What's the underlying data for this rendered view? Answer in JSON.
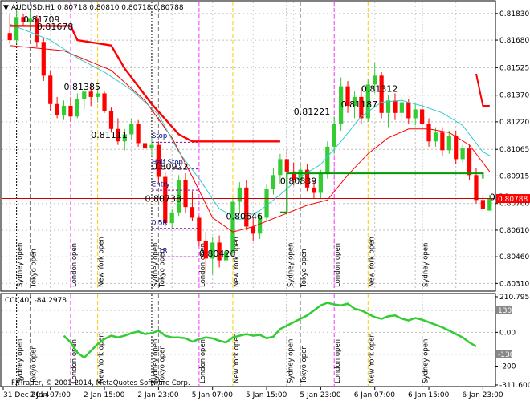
{
  "chart_data": {
    "type": "candlestick",
    "title": "AUDUSD,H1 0.80718 0.80810 0.80718 0.80788",
    "symbol": "AUDUSD,H1",
    "ohlc_header": [
      0.80718,
      0.8081,
      0.80718,
      0.80788
    ],
    "current_price": "0.80788",
    "price_axis": {
      "ylim": [
        0.8028,
        0.8187
      ],
      "ticks": [
        "0.81830",
        "0.81680",
        "0.81525",
        "0.81370",
        "0.81220",
        "0.81065",
        "0.80915",
        "0.80760",
        "0.80610",
        "0.80460",
        "0.80310"
      ]
    },
    "x_axis": {
      "ticks": [
        "31 Dec 2014",
        "2 Jan 07:00",
        "2 Jan 15:00",
        "2 Jan 23:00",
        "5 Jan 07:00",
        "5 Jan 15:00",
        "5 Jan 23:00",
        "6 Jan 07:00",
        "6 Jan 15:00",
        "6 Jan 23:00"
      ]
    },
    "candles": [
      {
        "o": 0.8172,
        "h": 0.8183,
        "l": 0.8166,
        "c": 0.8168
      },
      {
        "o": 0.8168,
        "h": 0.8185,
        "l": 0.8166,
        "c": 0.8181
      },
      {
        "o": 0.8181,
        "h": 0.8183,
        "l": 0.8176,
        "c": 0.8178
      },
      {
        "o": 0.8178,
        "h": 0.8184,
        "l": 0.8175,
        "c": 0.818
      },
      {
        "o": 0.818,
        "h": 0.8182,
        "l": 0.8164,
        "c": 0.8167
      },
      {
        "o": 0.8167,
        "h": 0.8169,
        "l": 0.8145,
        "c": 0.8148
      },
      {
        "o": 0.8148,
        "h": 0.8151,
        "l": 0.8128,
        "c": 0.8132
      },
      {
        "o": 0.8132,
        "h": 0.8136,
        "l": 0.8124,
        "c": 0.8126
      },
      {
        "o": 0.8126,
        "h": 0.8134,
        "l": 0.8123,
        "c": 0.8131
      },
      {
        "o": 0.8131,
        "h": 0.8136,
        "l": 0.8122,
        "c": 0.8125
      },
      {
        "o": 0.8125,
        "h": 0.8138,
        "l": 0.8124,
        "c": 0.8135
      },
      {
        "o": 0.8135,
        "h": 0.8141,
        "l": 0.8129,
        "c": 0.8139
      },
      {
        "o": 0.8139,
        "h": 0.8143,
        "l": 0.8131,
        "c": 0.8136
      },
      {
        "o": 0.8136,
        "h": 0.8141,
        "l": 0.8133,
        "c": 0.8138
      },
      {
        "o": 0.8138,
        "h": 0.8139,
        "l": 0.8127,
        "c": 0.8128
      },
      {
        "o": 0.8128,
        "h": 0.813,
        "l": 0.8116,
        "c": 0.8118
      },
      {
        "o": 0.8118,
        "h": 0.8124,
        "l": 0.8109,
        "c": 0.8111
      },
      {
        "o": 0.8111,
        "h": 0.8118,
        "l": 0.8106,
        "c": 0.8115
      },
      {
        "o": 0.8115,
        "h": 0.8124,
        "l": 0.8112,
        "c": 0.8121
      },
      {
        "o": 0.8121,
        "h": 0.8123,
        "l": 0.8108,
        "c": 0.811
      },
      {
        "o": 0.811,
        "h": 0.8114,
        "l": 0.8104,
        "c": 0.8107
      },
      {
        "o": 0.8107,
        "h": 0.8113,
        "l": 0.8103,
        "c": 0.8109
      },
      {
        "o": 0.8109,
        "h": 0.8111,
        "l": 0.8088,
        "c": 0.8091
      },
      {
        "o": 0.8091,
        "h": 0.8094,
        "l": 0.8063,
        "c": 0.8065
      },
      {
        "o": 0.8065,
        "h": 0.8073,
        "l": 0.8062,
        "c": 0.8071
      },
      {
        "o": 0.8071,
        "h": 0.8092,
        "l": 0.8069,
        "c": 0.8089
      },
      {
        "o": 0.8089,
        "h": 0.8093,
        "l": 0.8071,
        "c": 0.8074
      },
      {
        "o": 0.8074,
        "h": 0.8083,
        "l": 0.8066,
        "c": 0.8068
      },
      {
        "o": 0.8068,
        "h": 0.8069,
        "l": 0.8052,
        "c": 0.8055
      },
      {
        "o": 0.8055,
        "h": 0.806,
        "l": 0.8037,
        "c": 0.8045
      },
      {
        "o": 0.8045,
        "h": 0.8057,
        "l": 0.8036,
        "c": 0.8054
      },
      {
        "o": 0.8054,
        "h": 0.8058,
        "l": 0.804,
        "c": 0.8044
      },
      {
        "o": 0.8044,
        "h": 0.8051,
        "l": 0.8038,
        "c": 0.8049
      },
      {
        "o": 0.8049,
        "h": 0.8079,
        "l": 0.8046,
        "c": 0.8077
      },
      {
        "o": 0.8077,
        "h": 0.8088,
        "l": 0.807,
        "c": 0.8085
      },
      {
        "o": 0.8085,
        "h": 0.8089,
        "l": 0.8061,
        "c": 0.8063
      },
      {
        "o": 0.8063,
        "h": 0.8068,
        "l": 0.8055,
        "c": 0.8059
      },
      {
        "o": 0.8059,
        "h": 0.8071,
        "l": 0.8056,
        "c": 0.8068
      },
      {
        "o": 0.8068,
        "h": 0.8087,
        "l": 0.8066,
        "c": 0.8084
      },
      {
        "o": 0.8084,
        "h": 0.8096,
        "l": 0.8081,
        "c": 0.8092
      },
      {
        "o": 0.8092,
        "h": 0.8104,
        "l": 0.8087,
        "c": 0.8101
      },
      {
        "o": 0.8101,
        "h": 0.8106,
        "l": 0.8091,
        "c": 0.8094
      },
      {
        "o": 0.8094,
        "h": 0.8099,
        "l": 0.8086,
        "c": 0.8089
      },
      {
        "o": 0.8089,
        "h": 0.8097,
        "l": 0.8087,
        "c": 0.8095
      },
      {
        "o": 0.8095,
        "h": 0.8098,
        "l": 0.8083,
        "c": 0.8085
      },
      {
        "o": 0.8085,
        "h": 0.8089,
        "l": 0.8079,
        "c": 0.8082
      },
      {
        "o": 0.8082,
        "h": 0.8095,
        "l": 0.8079,
        "c": 0.8093
      },
      {
        "o": 0.8093,
        "h": 0.8111,
        "l": 0.809,
        "c": 0.8108
      },
      {
        "o": 0.8108,
        "h": 0.8125,
        "l": 0.8104,
        "c": 0.8121
      },
      {
        "o": 0.8121,
        "h": 0.8147,
        "l": 0.8117,
        "c": 0.8142
      },
      {
        "o": 0.8142,
        "h": 0.8145,
        "l": 0.8127,
        "c": 0.8131
      },
      {
        "o": 0.8131,
        "h": 0.8139,
        "l": 0.8124,
        "c": 0.8136
      },
      {
        "o": 0.8136,
        "h": 0.8141,
        "l": 0.8121,
        "c": 0.8124
      },
      {
        "o": 0.8124,
        "h": 0.8146,
        "l": 0.8122,
        "c": 0.8143
      },
      {
        "o": 0.8143,
        "h": 0.8155,
        "l": 0.8138,
        "c": 0.8148
      },
      {
        "o": 0.8148,
        "h": 0.815,
        "l": 0.8124,
        "c": 0.8127
      },
      {
        "o": 0.8127,
        "h": 0.8137,
        "l": 0.8119,
        "c": 0.8134
      },
      {
        "o": 0.8134,
        "h": 0.8138,
        "l": 0.8123,
        "c": 0.8127
      },
      {
        "o": 0.8127,
        "h": 0.8136,
        "l": 0.8122,
        "c": 0.8133
      },
      {
        "o": 0.8133,
        "h": 0.8135,
        "l": 0.8121,
        "c": 0.8124
      },
      {
        "o": 0.8124,
        "h": 0.8132,
        "l": 0.812,
        "c": 0.8129
      },
      {
        "o": 0.8129,
        "h": 0.8133,
        "l": 0.8118,
        "c": 0.8121
      },
      {
        "o": 0.8121,
        "h": 0.8124,
        "l": 0.8108,
        "c": 0.8111
      },
      {
        "o": 0.8111,
        "h": 0.8119,
        "l": 0.8108,
        "c": 0.8116
      },
      {
        "o": 0.8116,
        "h": 0.8119,
        "l": 0.8103,
        "c": 0.8106
      },
      {
        "o": 0.8106,
        "h": 0.8117,
        "l": 0.8104,
        "c": 0.8114
      },
      {
        "o": 0.8114,
        "h": 0.8117,
        "l": 0.8098,
        "c": 0.8101
      },
      {
        "o": 0.8101,
        "h": 0.8109,
        "l": 0.8099,
        "c": 0.8107
      },
      {
        "o": 0.8107,
        "h": 0.8109,
        "l": 0.8089,
        "c": 0.8092
      },
      {
        "o": 0.8092,
        "h": 0.8096,
        "l": 0.8076,
        "c": 0.8078
      },
      {
        "o": 0.8078,
        "h": 0.8081,
        "l": 0.8072,
        "c": 0.8073
      },
      {
        "o": 0.8072,
        "h": 0.8081,
        "l": 0.8072,
        "c": 0.8079
      }
    ],
    "ma_fast": [
      [
        0,
        0.8177
      ],
      [
        6,
        0.8168
      ],
      [
        10,
        0.8158
      ],
      [
        14,
        0.815
      ],
      [
        18,
        0.814
      ],
      [
        22,
        0.8126
      ],
      [
        25,
        0.8105
      ],
      [
        28,
        0.809
      ],
      [
        31,
        0.8073
      ],
      [
        34,
        0.8067
      ],
      [
        37,
        0.8072
      ],
      [
        40,
        0.8081
      ],
      [
        43,
        0.8091
      ],
      [
        46,
        0.8098
      ],
      [
        49,
        0.8111
      ],
      [
        52,
        0.8125
      ],
      [
        55,
        0.8133
      ],
      [
        58,
        0.8134
      ],
      [
        61,
        0.8131
      ],
      [
        64,
        0.8127
      ],
      [
        67,
        0.812
      ],
      [
        70,
        0.8105
      ],
      [
        71,
        0.8103
      ]
    ],
    "ma_slow": [
      [
        0,
        0.8165
      ],
      [
        8,
        0.8162
      ],
      [
        15,
        0.8151
      ],
      [
        20,
        0.8134
      ],
      [
        24,
        0.8113
      ],
      [
        27,
        0.8091
      ],
      [
        30,
        0.8068
      ],
      [
        33,
        0.806
      ],
      [
        36,
        0.8063
      ],
      [
        40,
        0.8069
      ],
      [
        44,
        0.8075
      ],
      [
        47,
        0.8078
      ],
      [
        50,
        0.8092
      ],
      [
        53,
        0.8104
      ],
      [
        56,
        0.8113
      ],
      [
        59,
        0.8118
      ],
      [
        62,
        0.8118
      ],
      [
        65,
        0.8116
      ],
      [
        68,
        0.8109
      ],
      [
        71,
        0.8094
      ]
    ],
    "stop_line": [
      [
        0,
        0.8176
      ],
      [
        9,
        0.8176
      ],
      [
        10,
        0.8168
      ],
      [
        15,
        0.8165
      ],
      [
        17,
        0.8152
      ],
      [
        21,
        0.8132
      ],
      [
        25,
        0.8115
      ],
      [
        27,
        0.8111
      ],
      [
        40,
        0.8111
      ]
    ],
    "stop_line2": [
      [
        69,
        0.8149
      ],
      [
        70,
        0.8131
      ],
      [
        71,
        0.8131
      ]
    ],
    "green_line": [
      [
        40,
        0.8071
      ],
      [
        41,
        0.8071
      ],
      [
        41,
        0.8093
      ],
      [
        70,
        0.8093
      ],
      [
        70,
        0.809
      ]
    ],
    "horizontal_line": 0.80788,
    "level_labels": [
      {
        "text": "0.81709",
        "bar": 2,
        "y": 0.8178
      },
      {
        "text": "0.81678",
        "bar": 4,
        "y": 0.8174
      },
      {
        "text": "0.81385",
        "bar": 8,
        "y": 0.814
      },
      {
        "text": "0.81111",
        "bar": 12,
        "y": 0.8113
      },
      {
        "text": "0.80922",
        "bar": 21,
        "y": 0.8095
      },
      {
        "text": "0.80738",
        "bar": 20,
        "y": 0.8077
      },
      {
        "text": "0.80646",
        "bar": 32,
        "y": 0.8067
      },
      {
        "text": "0.80426",
        "bar": 28,
        "y": 0.8046
      },
      {
        "text": "0.80839",
        "bar": 40,
        "y": 0.8087
      },
      {
        "text": "0.81221",
        "bar": 42,
        "y": 0.8126
      },
      {
        "text": "0.81187",
        "bar": 49,
        "y": 0.813
      },
      {
        "text": "0.81312",
        "bar": 52,
        "y": 0.8139
      },
      {
        "text": "0.80",
        "bar": 71,
        "y": 0.8078
      }
    ],
    "trade_labels": [
      {
        "text": "Stop",
        "bar": 21,
        "y": 0.8113
      },
      {
        "text": "Half Stop",
        "bar": 21,
        "y": 0.8098
      },
      {
        "text": "Entry",
        "bar": 21,
        "y": 0.80855
      },
      {
        "text": "0.5R",
        "bar": 21,
        "y": 0.8064
      },
      {
        "text": "1R",
        "bar": 22,
        "y": 0.8048
      }
    ],
    "trade_lines": [
      {
        "bar_start": 21,
        "bar_end": 28,
        "y": 0.81105
      },
      {
        "bar_start": 21,
        "bar_end": 28,
        "y": 0.80955
      },
      {
        "bar_start": 21,
        "bar_end": 28,
        "y": 0.80835
      },
      {
        "bar_start": 21,
        "bar_end": 28,
        "y": 0.8062
      },
      {
        "bar_start": 21,
        "bar_end": 28,
        "y": 0.8046
      }
    ],
    "session_lines": [
      {
        "bar": 1,
        "label": "Sydney open",
        "color": "#000000",
        "style": "dotted"
      },
      {
        "bar": 3,
        "label": "Tokyo open",
        "color": "#7A7A7A",
        "style": "dashed"
      },
      {
        "bar": 9,
        "label": "London open",
        "color": "#FF33FF",
        "style": "dashed"
      },
      {
        "bar": 13,
        "label": "New York open",
        "color": "#FFCC00",
        "style": "dashed"
      },
      {
        "bar": 21,
        "label": "Sydney open",
        "color": "#000000",
        "style": "dotted"
      },
      {
        "bar": 22,
        "label": "Tokyo open",
        "color": "#7A7A7A",
        "style": "dashed"
      },
      {
        "bar": 28,
        "label": "London open",
        "color": "#FF33FF",
        "style": "dashed"
      },
      {
        "bar": 33,
        "label": "New York open",
        "color": "#FFCC00",
        "style": "dashed"
      },
      {
        "bar": 41,
        "label": "Sydney open",
        "color": "#000000",
        "style": "dotted"
      },
      {
        "bar": 43,
        "label": "Tokyo open",
        "color": "#7A7A7A",
        "style": "dashed"
      },
      {
        "bar": 48,
        "label": "London open",
        "color": "#FF33FF",
        "style": "dashed"
      },
      {
        "bar": 53,
        "label": "New York open",
        "color": "#FFCC00",
        "style": "dashed"
      },
      {
        "bar": 61,
        "label": "Sydney open",
        "color": "#000000",
        "style": "dotted"
      }
    ],
    "indicator": {
      "name": "CCI(40) -84.2978",
      "ylim": [
        -311.6009,
        210.7951
      ],
      "ticks": [
        "210.7951",
        "130",
        "0.00",
        "-130",
        "-200",
        "-311.6009"
      ],
      "values": [
        -20,
        -60,
        -120,
        -150,
        -110,
        -70,
        -40,
        -20,
        -30,
        -20,
        -5,
        5,
        -10,
        -5,
        10,
        -20,
        -30,
        -30,
        -35,
        -55,
        -40,
        -30,
        -35,
        -50,
        -60,
        -30,
        -20,
        -10,
        -20,
        -15,
        -35,
        -25,
        20,
        40,
        60,
        80,
        100,
        130,
        160,
        175,
        165,
        160,
        170,
        140,
        130,
        110,
        90,
        80,
        95,
        100,
        80,
        70,
        85,
        75,
        60,
        45,
        30,
        10,
        -10,
        -30,
        -60,
        -84
      ],
      "values_bar_offset": 8
    },
    "watermark": "FXTrader, © 2001-2014, MetaQuotes Software Corp.",
    "colors": {
      "bull": "#33CC33",
      "bear": "#FF0000",
      "ma_fast": "#33CCCC",
      "ma_slow": "#FF0000",
      "stop": "#FF0000",
      "green": "#009900",
      "cci": "#33CC33",
      "grid": "#C0C0C0",
      "current_price_bg": "#FF0000",
      "labels": "#000080"
    }
  }
}
